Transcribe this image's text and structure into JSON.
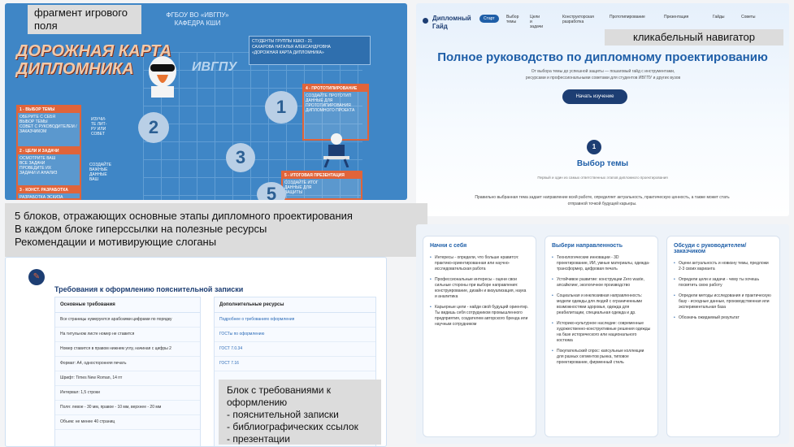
{
  "map": {
    "header": "ФГБОУ ВО «ИВГПУ»\nКАФЕДРА КШИ",
    "title": "ДОРОЖНАЯ КАРТА\nДИПЛОМНИКА",
    "logo": "ИВГПУ",
    "subtitle": "СТУДЕНТЫ ГРУППЫ КШКЗ - 21\nСАХАРОВА НАТАЛЬЯ АЛЕКСАНДРОВНА\n«ДОРОЖНАЯ КАРТА ДИПЛОМНИКА»",
    "blocks": [
      {
        "title": "1 - ВЫБОР ТЕМЫ",
        "text": "ОБЕРИТЕ С СЕБЯ\nВЫБОР ТЕМЫ\nСОВЕТ С РУКОВОДИТЕЛЕМ /\nЗАКАЗЧИКОМ"
      },
      {
        "title": "2 - ЦЕЛИ И ЗАДАЧИ",
        "text": "ОСМОТРИТЕ ВАШ\nВСЕ ЗАДАЧИ\nПРОВЕДИТЕ ИХ\nЗАДАЧИ И АНАЛИЗ"
      },
      {
        "title": "3 - КОНСТ. РАЗРАБОТКА",
        "text": "РАЗРАБОТКА ЭСКИЗА"
      },
      {
        "title": "4 - ПРОТОТИПИРОВАНИЕ",
        "text": "СОЗДАЙТЕ ПРОТОТИП\nДАННЫЕ ДЛЯ\nПРОТОТИПИРОВАНИЯ\nДИПЛОМНОГО ПРОЕКТА"
      },
      {
        "title": "5 - ИТОГОВАЯ ПРЕЗЕНТАЦИЯ",
        "text": "СОЗДАЙТЕ ИТОГ\nДАННЫЕ ДЛЯ\nЗАЩИТЫ"
      }
    ],
    "side_text1": "ИЗУЧИ-\nТЕ ЛИТ-\nРУ ИЛИ\nСОВЕТ",
    "side_text2": "СОЗДАЙТЕ\nВАЖНЫЕ\nДАННЫЕ\nВАШ",
    "circles": [
      "1",
      "2",
      "3",
      "5"
    ],
    "label_over_top": "фрагмент игрового\nполя"
  },
  "site": {
    "brand": "Дипломный\nГайд",
    "nav": {
      "start": "Старт",
      "items": [
        "Выбор\nтемы",
        "Цели\nи\nзадачи",
        "Конструкторская\nразработка",
        "Прототипирование",
        "Презентация",
        "Гайды",
        "Советы"
      ]
    },
    "hero_title": "Полное руководство по дипломному проектированию",
    "hero_text": "От выбора темы до успешной защиты — пошаговый гайд с инструментами,\nресурсами и профессиональными советами для студентов ИВГПУ и других вузов",
    "cta": "Начать изучение",
    "step_number": "1",
    "step_title": "Выбор темы",
    "step_sub": "Первый и один из самых ответственных этапов дипломного проектирования",
    "step_text": "Правильно выбранная тема задает направление всей работе, определяет актуальность, практическую ценность, а также может стать\nотправной точкой будущей карьеры.",
    "navigator_label": "кликабельный навигатор"
  },
  "middle_note": {
    "lines": [
      "5 блоков, отражающих основные этапы дипломного проектирования",
      "В каждом блоке гиперссылки на полезные ресурсы",
      "Рекомендации и мотивирующие слоганы"
    ]
  },
  "requirements": {
    "icon_label": "✎",
    "title": "Требования к оформлению пояснительной записки",
    "left_header": "Основные требования",
    "left_rows": [
      "Все страницы нумеруются арабскими цифрами по порядку",
      "На титульном листе номер не ставится",
      "Номер ставится в правом нижнем углу, начиная с цифры 2",
      "Формат: А4, односторонняя печать",
      "Шрифт: Times New Roman, 14 пт",
      "Интервал: 1,5 строки",
      "Поля: левое - 30 мм, правое - 10 мм, верхнее - 20 мм",
      "Объем: не менее 40 страниц"
    ],
    "right_header": "Дополнительные ресурсы",
    "right_rows": [
      "Подробнее о требованиях оформления",
      "ГОСТы по оформлению",
      "ГОСТ 7.0.34",
      "ГОСТ 7.16"
    ],
    "note_title": "Блок с требованиями к оформлению",
    "note_lines": [
      "- пояснительной записки",
      "- библиографических ссылок",
      "- презентации"
    ]
  },
  "cards": [
    {
      "title": "Начни с себя",
      "items": [
        "Интересы - определи, что больше нравится: практико-ориентированная или научно-исследовательская работа",
        "Профессиональные интересы - оцени свои сильные стороны при выборе направления: конструирование, дизайн и визуализация, наука и аналитика",
        "Карьерные цели - найди свой будущий ориентир. Ты видишь себя сотрудником промышленного предприятия, создателем авторского бренда или научным сотрудником"
      ]
    },
    {
      "title": "Выбери направленность",
      "items": [
        "Технологические инновации - 3D проектирование, ИИ, умные материалы, одежда-трансформер, цифровая печать",
        "Устойчивое развитие: конструкции Zero waste, апсайклинг, экологичное производство",
        "Социальная и инклюзивная направленность: модели одежды для людей с ограниченными возможностями здоровья, одежда для реабилитации, специальная одежда и др.",
        "Историко-культурное наследие: современные художественно-конструктивные решения одежды на базе исторического или национального костюма",
        "Покупательский спрос: капсульные коллекции для разных сегментов рынка, типовое проектирование, фирменный стиль"
      ]
    },
    {
      "title": "Обсуди с руководителем/ заказчиком",
      "items": [
        "Оцени актуальность и новизну темы, предложи 2-3 своих варианта",
        "Определи цели и задачи - чему ты хочешь посвятить свою работу",
        "Определи методы исследования и практическую базу - исходные данные, производственная или экспериментальная база",
        "Обозначь ожидаемый результат"
      ]
    }
  ],
  "colors": {
    "accent": "#1f5fa8",
    "map_bg": "#3f86c6",
    "orange": "#e0643a"
  }
}
